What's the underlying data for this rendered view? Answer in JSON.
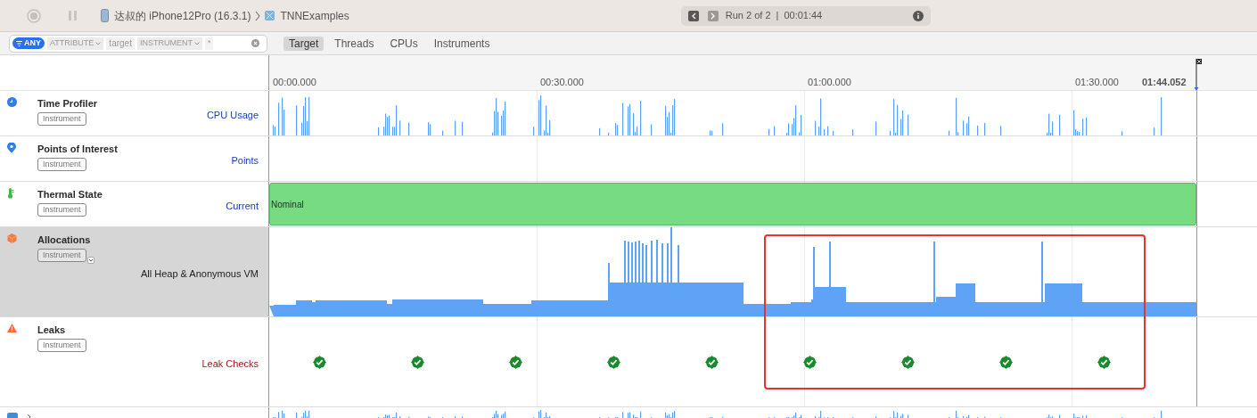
{
  "toolbar": {
    "record_disabled": true,
    "device": "达叔的 iPhone12Pro (16.3.1)",
    "target": "TNNExamples",
    "run": "Run 2 of 2",
    "separator": "|",
    "duration": "00:01:44",
    "prev_enabled": true,
    "next_enabled": false
  },
  "filter": {
    "any": "ANY",
    "attribute": "ATTRIBUTE",
    "attribute_value": "target",
    "instrument": "INSTRUMENT",
    "instrument_value": "*"
  },
  "tabs": [
    {
      "label": "Target",
      "selected": true
    },
    {
      "label": "Threads",
      "selected": false
    },
    {
      "label": "CPUs",
      "selected": false
    },
    {
      "label": "Instruments",
      "selected": false
    }
  ],
  "ruler": {
    "ticks": [
      "00:00.000",
      "00:30.000",
      "01:00.000",
      "01:30.000"
    ],
    "end": "01:44.052"
  },
  "tracks": [
    {
      "kind": "cpu",
      "name": "Time Profiler",
      "tag": "Instrument",
      "detail": "CPU Usage",
      "color": "#1a3fb8",
      "selected": false
    },
    {
      "kind": "points",
      "name": "Points of Interest",
      "tag": "Instrument",
      "detail": "Points",
      "color": "#1a3fb8",
      "selected": false
    },
    {
      "kind": "thermal",
      "name": "Thermal State",
      "tag": "Instrument",
      "detail": "Current",
      "color": "#1a3fb8",
      "selected": false,
      "state": "Nominal"
    },
    {
      "kind": "allocations",
      "name": "Allocations",
      "tag": "Instrument",
      "detail": "All Heap & Anonymous VM",
      "color": "#222222",
      "selected": true
    },
    {
      "kind": "leaks",
      "name": "Leaks",
      "tag": "Instrument",
      "detail": "Leak Checks",
      "color": "#a11b1b",
      "selected": false,
      "checks": [
        {
          "ok": true
        },
        {
          "ok": true
        },
        {
          "ok": true
        },
        {
          "ok": true
        },
        {
          "ok": true
        },
        {
          "ok": true
        },
        {
          "ok": true
        },
        {
          "ok": true
        },
        {
          "ok": true
        }
      ]
    }
  ]
}
